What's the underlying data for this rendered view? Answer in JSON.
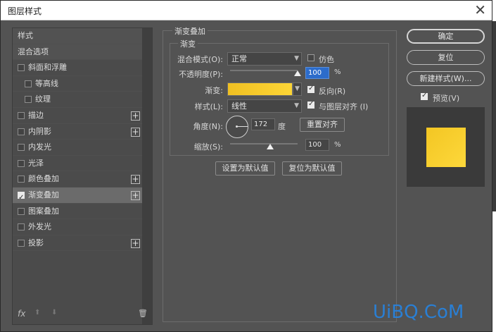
{
  "window": {
    "title": "图层样式",
    "close_glyph": "✕"
  },
  "left_panel": {
    "header": "样式",
    "blend_options": "混合选项",
    "items": [
      {
        "label": "斜面和浮雕",
        "checked": false,
        "indent": false,
        "plus": false
      },
      {
        "label": "等高线",
        "checked": false,
        "indent": true,
        "plus": false
      },
      {
        "label": "纹理",
        "checked": false,
        "indent": true,
        "plus": false
      },
      {
        "label": "描边",
        "checked": false,
        "indent": false,
        "plus": true
      },
      {
        "label": "内阴影",
        "checked": false,
        "indent": false,
        "plus": true
      },
      {
        "label": "内发光",
        "checked": false,
        "indent": false,
        "plus": false
      },
      {
        "label": "光泽",
        "checked": false,
        "indent": false,
        "plus": false
      },
      {
        "label": "颜色叠加",
        "checked": false,
        "indent": false,
        "plus": true
      },
      {
        "label": "渐变叠加",
        "checked": true,
        "indent": false,
        "plus": true,
        "selected": true
      },
      {
        "label": "图案叠加",
        "checked": false,
        "indent": false,
        "plus": false
      },
      {
        "label": "外发光",
        "checked": false,
        "indent": false,
        "plus": false
      },
      {
        "label": "投影",
        "checked": false,
        "indent": false,
        "plus": true
      }
    ],
    "footer": {
      "fx": "fx",
      "up": "⬆",
      "down": "⬇",
      "trash": "🗑"
    }
  },
  "gradient_overlay": {
    "section_title": "渐变叠加",
    "group_title": "渐变",
    "blend_mode_label": "混合模式(O):",
    "blend_mode_value": "正常",
    "dither_label": "仿色",
    "dither_checked": false,
    "opacity_label": "不透明度(P):",
    "opacity_value": "100",
    "opacity_unit": "%",
    "opacity_level": 1.0,
    "gradient_label": "渐变:",
    "gradient_colors": [
      "#f0c022",
      "#fcd536"
    ],
    "reverse_label": "反向(R)",
    "reverse_checked": true,
    "style_label": "样式(L):",
    "style_value": "线性",
    "align_label": "与图层对齐 (I)",
    "align_checked": true,
    "angle_label": "角度(N):",
    "angle_value": "172",
    "angle_unit": "度",
    "reset_align_label": "重置对齐",
    "scale_label": "缩放(S):",
    "scale_value": "100",
    "scale_unit": "%",
    "scale_level": 0.5,
    "make_default_label": "设置为默认值",
    "reset_default_label": "复位为默认值"
  },
  "right_panel": {
    "ok_label": "确定",
    "reset_label": "复位",
    "new_style_label": "新建样式(W)...",
    "preview_label": "预览(V)",
    "preview_checked": true,
    "preview_color": "#f8cf2e"
  },
  "watermark": "UiBQ.CoM",
  "colors": {
    "accent": "#2c6ccb",
    "dialog_bg": "#535353"
  }
}
